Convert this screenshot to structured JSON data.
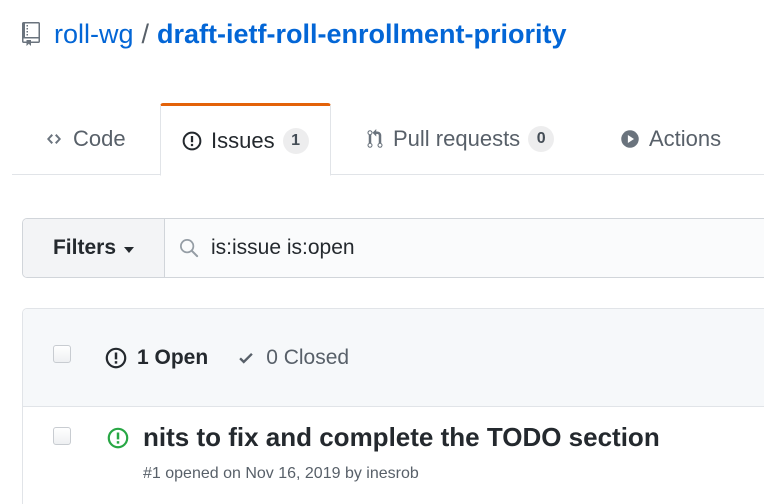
{
  "repo": {
    "owner": "roll-wg",
    "separator": "/",
    "name": "draft-ietf-roll-enrollment-priority"
  },
  "tabs": [
    {
      "label": "Code",
      "icon": "code-icon"
    },
    {
      "label": "Issues",
      "icon": "issue-opened-icon",
      "count": "1",
      "selected": true
    },
    {
      "label": "Pull requests",
      "icon": "git-pull-request-icon",
      "count": "0"
    },
    {
      "label": "Actions",
      "icon": "play-icon"
    }
  ],
  "filters": {
    "button_label": "Filters",
    "search_value": "is:issue is:open"
  },
  "issues_header": {
    "open_label": "1 Open",
    "closed_label": "0 Closed"
  },
  "issues": [
    {
      "title": "nits to fix and complete the TODO section",
      "meta": "#1 opened on Nov 16, 2019 by inesrob"
    }
  ],
  "colors": {
    "link": "#0366d6",
    "tab_accent": "#e36209",
    "open_green": "#28a745",
    "muted": "#586069"
  }
}
